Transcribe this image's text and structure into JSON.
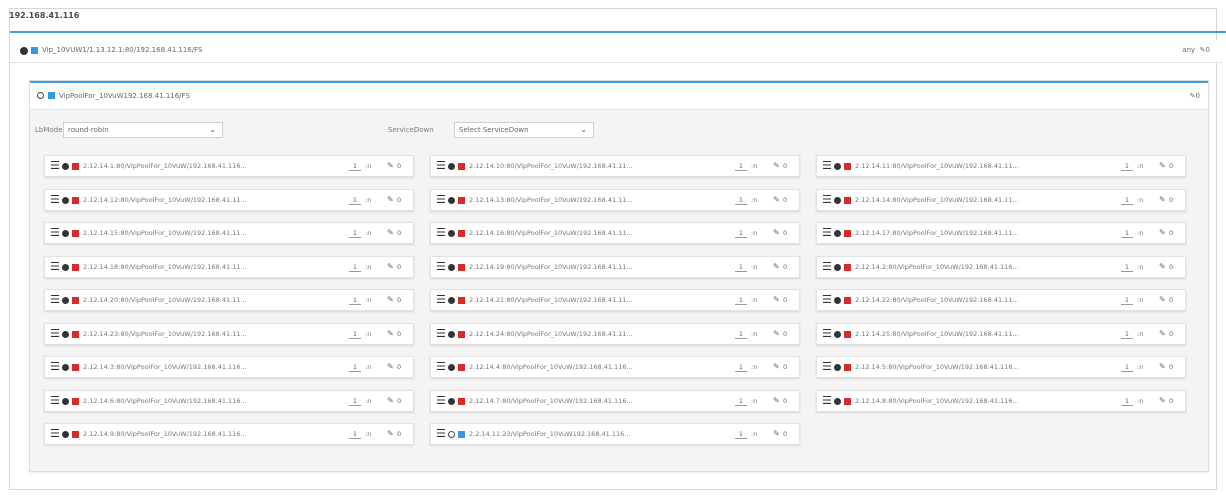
{
  "header": {
    "title": "192.168.41.116"
  },
  "vip": {
    "label": "Vip_10VUW1/1.13.12.1:80/192.168.41.116/FS",
    "right_text": "any",
    "edit_count": "0"
  },
  "pool": {
    "label": "VipPoolFor_10VuW192.168.41.116/FS",
    "edit_count": "0",
    "lb_mode_label": "LbMode",
    "lb_mode_value": "round-robin",
    "service_down_label": "ServiceDown",
    "service_down_value": "Select ServiceDown"
  },
  "members": [
    {
      "label": "2.12.14.1:80/VipPoolFor_10VuW/192.168.41.116...",
      "weight": "1",
      "unit": ":n",
      "count": "0",
      "status": "up"
    },
    {
      "label": "2.12.14.10:80/VipPoolFor_10VuW/192.168.41.11...",
      "weight": "1",
      "unit": ":n",
      "count": "0",
      "status": "up"
    },
    {
      "label": "2.12.14.11:80/VipPoolFor_10VuW/192.168.41.11...",
      "weight": "1",
      "unit": ":n",
      "count": "0",
      "status": "up"
    },
    {
      "label": "2.12.14.12:80/VipPoolFor_10VuW/192.168.41.11...",
      "weight": "1",
      "unit": ":n",
      "count": "0",
      "status": "up"
    },
    {
      "label": "2.12.14.13:80/VipPoolFor_10VuW/192.168.41.11...",
      "weight": "1",
      "unit": ":n",
      "count": "0",
      "status": "up"
    },
    {
      "label": "2.12.14.14:80/VipPoolFor_10VuW/192.168.41.11...",
      "weight": "1",
      "unit": ":n",
      "count": "0",
      "status": "up"
    },
    {
      "label": "2.12.14.15:80/VipPoolFor_10VuW/192.168.41.11...",
      "weight": "1",
      "unit": ":n",
      "count": "0",
      "status": "up"
    },
    {
      "label": "2.12.14.16:80/VipPoolFor_10VuW/192.168.41.11...",
      "weight": "1",
      "unit": ":n",
      "count": "0",
      "status": "up"
    },
    {
      "label": "2.12.14.17:80/VipPoolFor_10VuW/192.168.41.11...",
      "weight": "1",
      "unit": ":n",
      "count": "0",
      "status": "up"
    },
    {
      "label": "2.12.14.18:80/VipPoolFor_10VuW/192.168.41.11...",
      "weight": "1",
      "unit": ":n",
      "count": "0",
      "status": "up"
    },
    {
      "label": "2.12.14.19:80/VipPoolFor_10VuW/192.168.41.11...",
      "weight": "1",
      "unit": ":n",
      "count": "0",
      "status": "up"
    },
    {
      "label": "2.12.14.2:80/VipPoolFor_10VuW/192.168.41.116...",
      "weight": "1",
      "unit": ":n",
      "count": "0",
      "status": "up"
    },
    {
      "label": "2.12.14.20:80/VipPoolFor_10VuW/192.168.41.11...",
      "weight": "1",
      "unit": ":n",
      "count": "0",
      "status": "up"
    },
    {
      "label": "2.12.14.21:80/VipPoolFor_10VuW/192.168.41.11...",
      "weight": "1",
      "unit": ":n",
      "count": "0",
      "status": "up"
    },
    {
      "label": "2.12.14.22:80/VipPoolFor_10VuW/192.168.41.11...",
      "weight": "1",
      "unit": ":n",
      "count": "0",
      "status": "up"
    },
    {
      "label": "2.12.14.23:80/VipPoolFor_10VuW/192.168.41.11...",
      "weight": "1",
      "unit": ":n",
      "count": "0",
      "status": "up"
    },
    {
      "label": "2.12.14.24:80/VipPoolFor_10VuW/192.168.41.11...",
      "weight": "1",
      "unit": ":n",
      "count": "0",
      "status": "up"
    },
    {
      "label": "2.12.14.25:80/VipPoolFor_10VuW/192.168.41.11...",
      "weight": "1",
      "unit": ":n",
      "count": "0",
      "status": "up"
    },
    {
      "label": "2.12.14.3:80/VipPoolFor_10VuW/192.168.41.116...",
      "weight": "1",
      "unit": ":n",
      "count": "0",
      "status": "up"
    },
    {
      "label": "2.12.14.4:80/VipPoolFor_10VuW/192.168.41.116...",
      "weight": "1",
      "unit": ":n",
      "count": "0",
      "status": "up"
    },
    {
      "label": "2.12.14.5:80/VipPoolFor_10VuW/192.168.41.116...",
      "weight": "1",
      "unit": ":n",
      "count": "0",
      "status": "up"
    },
    {
      "label": "2.12.14.6:80/VipPoolFor_10VuW/192.168.41.116...",
      "weight": "1",
      "unit": ":n",
      "count": "0",
      "status": "up"
    },
    {
      "label": "2.12.14.7:80/VipPoolFor_10VuW/192.168.41.116...",
      "weight": "1",
      "unit": ":n",
      "count": "0",
      "status": "up"
    },
    {
      "label": "2.12.14.8:80/VipPoolFor_10VuW/192.168.41.116...",
      "weight": "1",
      "unit": ":n",
      "count": "0",
      "status": "up"
    },
    {
      "label": "2.12.14.9:80/VipPoolFor_10VuW/192.168.41.116...",
      "weight": "1",
      "unit": ":n",
      "count": "0",
      "status": "up"
    },
    {
      "label": "2.2.14.11:23/VipPoolFor_10VuW192.168.41.116...",
      "weight": "1",
      "unit": ":n",
      "count": "0",
      "status": "other"
    }
  ],
  "colors": {
    "accent": "#3b9fdc",
    "member_red": "#d62b2b",
    "member_blue": "#2f9be0"
  }
}
